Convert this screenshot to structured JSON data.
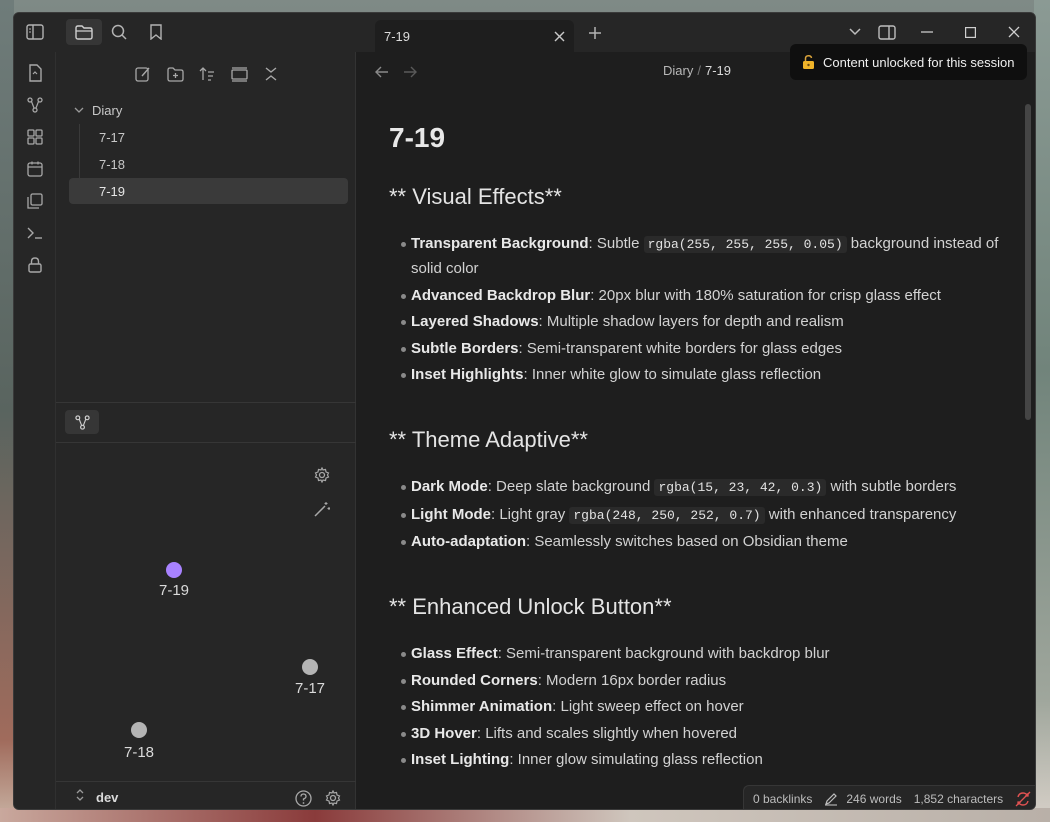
{
  "tab": {
    "title": "7-19"
  },
  "breadcrumb": {
    "folder": "Diary",
    "separator": "/",
    "current": "7-19"
  },
  "toast": {
    "text": "Content unlocked for this session"
  },
  "tree": {
    "folder": "Diary",
    "files": [
      "7-17",
      "7-18",
      "7-19"
    ],
    "active": "7-19"
  },
  "graph": {
    "nodes": [
      {
        "label": "7-19",
        "color": "#a882ff"
      },
      {
        "label": "7-17",
        "color": "#b4b4b4"
      },
      {
        "label": "7-18",
        "color": "#b4b4b4"
      }
    ]
  },
  "vault": {
    "name": "dev"
  },
  "doc": {
    "title": "7-19",
    "sections": [
      {
        "heading": "** Visual Effects**",
        "items": [
          {
            "bold": "Transparent Background",
            "pre": ": Subtle ",
            "code": "rgba(255, 255, 255, 0.05)",
            "post": " background instead of solid color"
          },
          {
            "bold": "Advanced Backdrop Blur",
            "pre": ": 20px blur with 180% saturation for crisp glass effect",
            "code": "",
            "post": ""
          },
          {
            "bold": "Layered Shadows",
            "pre": ": Multiple shadow layers for depth and realism",
            "code": "",
            "post": ""
          },
          {
            "bold": "Subtle Borders",
            "pre": ": Semi-transparent white borders for glass edges",
            "code": "",
            "post": ""
          },
          {
            "bold": "Inset Highlights",
            "pre": ": Inner white glow to simulate glass reflection",
            "code": "",
            "post": ""
          }
        ]
      },
      {
        "heading": "** Theme Adaptive**",
        "items": [
          {
            "bold": "Dark Mode",
            "pre": ": Deep slate background ",
            "code": "rgba(15, 23, 42, 0.3)",
            "post": " with subtle borders"
          },
          {
            "bold": "Light Mode",
            "pre": ": Light gray ",
            "code": "rgba(248, 250, 252, 0.7)",
            "post": " with enhanced transparency"
          },
          {
            "bold": "Auto-adaptation",
            "pre": ": Seamlessly switches based on Obsidian theme",
            "code": "",
            "post": ""
          }
        ]
      },
      {
        "heading": "** Enhanced Unlock Button**",
        "items": [
          {
            "bold": "Glass Effect",
            "pre": ": Semi-transparent background with backdrop blur",
            "code": "",
            "post": ""
          },
          {
            "bold": "Rounded Corners",
            "pre": ": Modern 16px border radius",
            "code": "",
            "post": ""
          },
          {
            "bold": "Shimmer Animation",
            "pre": ": Light sweep effect on hover",
            "code": "",
            "post": ""
          },
          {
            "bold": "3D Hover",
            "pre": ": Lifts and scales slightly when hovered",
            "code": "",
            "post": ""
          },
          {
            "bold": "Inset Lighting",
            "pre": ": Inner glow simulating glass reflection",
            "code": "",
            "post": ""
          }
        ]
      }
    ]
  },
  "status": {
    "backlinks": "0 backlinks",
    "words": "246 words",
    "characters": "1,852 characters"
  },
  "colors": {
    "accent": "#a882ff",
    "sync_error": "#e05252"
  }
}
